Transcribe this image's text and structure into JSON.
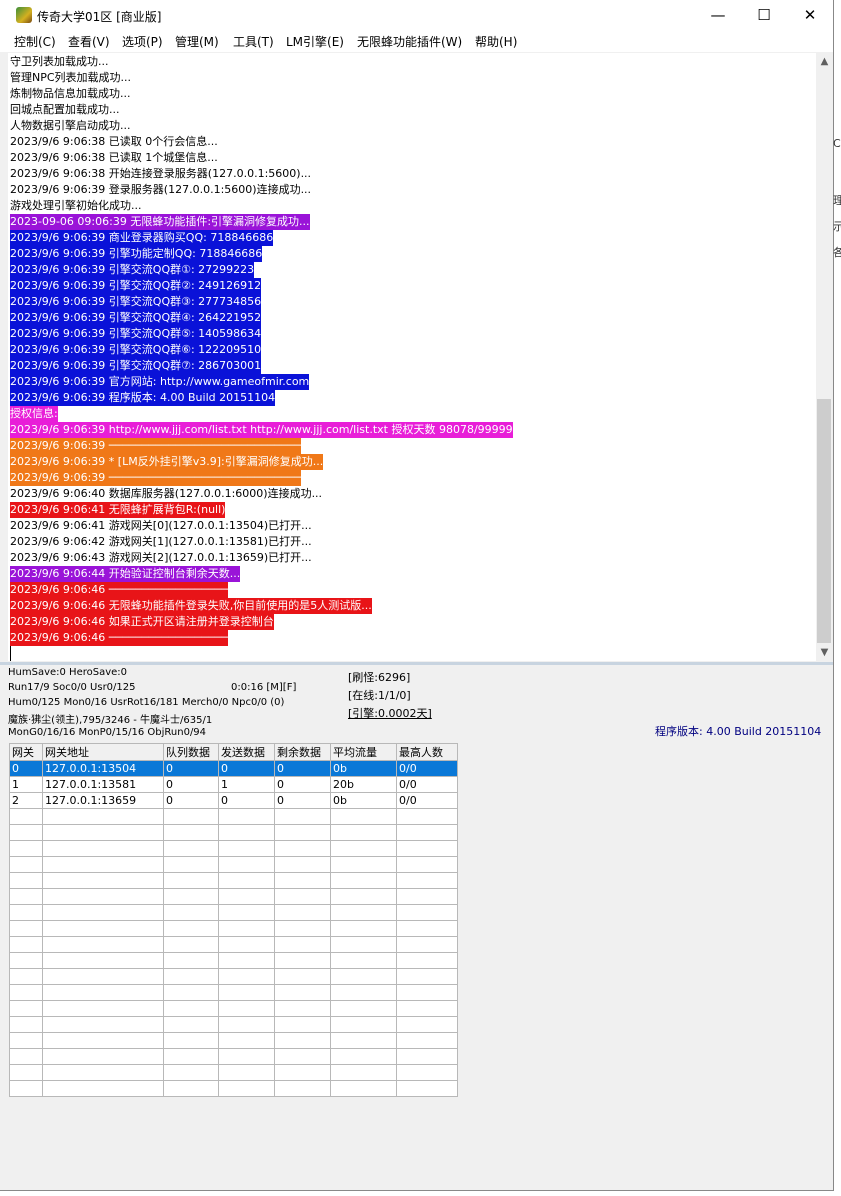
{
  "window": {
    "title": "传奇大学01区 [商业版]",
    "controls": {
      "minimize": "—",
      "maximize": "☐",
      "close": "✕"
    }
  },
  "menu": [
    "控制(C)",
    "查看(V)",
    "选项(P)",
    "管理(M)",
    "工具(T)",
    "LM引擎(E)",
    "无限蜂功能插件(W)",
    "帮助(H)"
  ],
  "log_lines": [
    {
      "text": "守卫列表加载成功...",
      "bg": "",
      "fg": "#000000"
    },
    {
      "text": "管理NPC列表加载成功...",
      "bg": "",
      "fg": "#000000"
    },
    {
      "text": "炼制物品信息加载成功...",
      "bg": "",
      "fg": "#000000"
    },
    {
      "text": "回城点配置加载成功...",
      "bg": "",
      "fg": "#000000"
    },
    {
      "text": "人物数据引擎启动成功...",
      "bg": "",
      "fg": "#000000"
    },
    {
      "text": "2023/9/6 9:06:38 已读取 0个行会信息...",
      "bg": "",
      "fg": "#000000"
    },
    {
      "text": "2023/9/6 9:06:38 已读取 1个城堡信息...",
      "bg": "",
      "fg": "#000000"
    },
    {
      "text": "2023/9/6 9:06:38 开始连接登录服务器(127.0.0.1:5600)...",
      "bg": "",
      "fg": "#000000"
    },
    {
      "text": "2023/9/6 9:06:39 登录服务器(127.0.0.1:5600)连接成功...",
      "bg": "",
      "fg": "#000000"
    },
    {
      "text": "游戏处理引擎初始化成功...",
      "bg": "",
      "fg": "#000000"
    },
    {
      "text": "2023-09-06 09:06:39 无限蜂功能插件:引擎漏洞修复成功...",
      "bg": "#9a14d8",
      "fg": "#ffffff"
    },
    {
      "text": "2023/9/6 9:06:39 商业登录器购买QQ: 718846686",
      "bg": "#0a12d8",
      "fg": "#ffffff"
    },
    {
      "text": "2023/9/6 9:06:39 引擎功能定制QQ: 718846686",
      "bg": "#0a12d8",
      "fg": "#ffffff"
    },
    {
      "text": "2023/9/6 9:06:39 引擎交流QQ群①: 27299223",
      "bg": "#0a12d8",
      "fg": "#ffffff"
    },
    {
      "text": "2023/9/6 9:06:39 引擎交流QQ群②: 249126912",
      "bg": "#0a12d8",
      "fg": "#ffffff"
    },
    {
      "text": "2023/9/6 9:06:39 引擎交流QQ群③: 277734856",
      "bg": "#0a12d8",
      "fg": "#ffffff"
    },
    {
      "text": "2023/9/6 9:06:39 引擎交流QQ群④: 264221952",
      "bg": "#0a12d8",
      "fg": "#ffffff"
    },
    {
      "text": "2023/9/6 9:06:39 引擎交流QQ群⑤: 140598634",
      "bg": "#0a12d8",
      "fg": "#ffffff"
    },
    {
      "text": "2023/9/6 9:06:39 引擎交流QQ群⑥: 122209510",
      "bg": "#0a12d8",
      "fg": "#ffffff"
    },
    {
      "text": "2023/9/6 9:06:39 引擎交流QQ群⑦: 286703001",
      "bg": "#0a12d8",
      "fg": "#ffffff"
    },
    {
      "text": "2023/9/6 9:06:39 官方网站: http://www.gameofmir.com",
      "bg": "#0a12d8",
      "fg": "#ffffff"
    },
    {
      "text": "2023/9/6 9:06:39 程序版本: 4.00 Build 20151104",
      "bg": "#0a12d8",
      "fg": "#ffffff"
    },
    {
      "text": "授权信息:",
      "bg": "#e81ed8",
      "fg": "#ffffff"
    },
    {
      "text": "2023/9/6 9:06:39 http://www.jjj.com/list.txt http://www.jjj.com/list.txt 授权天数 98078/99999",
      "bg": "#e81ed8",
      "fg": "#ffffff"
    },
    {
      "text": "2023/9/6 9:06:39 ─────────────────────────────",
      "bg": "#f07818",
      "fg": "#ffffff"
    },
    {
      "text": "2023/9/6 9:06:39 * [LM反外挂引擎v3.9]:引擎漏洞修复成功...",
      "bg": "#f07818",
      "fg": "#ffffff"
    },
    {
      "text": "2023/9/6 9:06:39 ─────────────────────────────",
      "bg": "#f07818",
      "fg": "#ffffff"
    },
    {
      "text": "2023/9/6 9:06:40 数据库服务器(127.0.0.1:6000)连接成功...",
      "bg": "",
      "fg": "#000000"
    },
    {
      "text": "2023/9/6 9:06:41 无限蜂扩展背包R:(null)",
      "bg": "#e81418",
      "fg": "#ffffff"
    },
    {
      "text": "2023/9/6 9:06:41 游戏网关[0](127.0.0.1:13504)已打开...",
      "bg": "",
      "fg": "#000000"
    },
    {
      "text": "2023/9/6 9:06:42 游戏网关[1](127.0.0.1:13581)已打开...",
      "bg": "",
      "fg": "#000000"
    },
    {
      "text": "2023/9/6 9:06:43 游戏网关[2](127.0.0.1:13659)已打开...",
      "bg": "",
      "fg": "#000000"
    },
    {
      "text": "2023/9/6 9:06:44 开始验证控制台剩余天数...",
      "bg": "#9a14d8",
      "fg": "#ffffff"
    },
    {
      "text": "2023/9/6 9:06:46 ──────────────────",
      "bg": "#e81418",
      "fg": "#ffffff"
    },
    {
      "text": "2023/9/6 9:06:46 无限蜂功能插件登录失败,你目前使用的是5人测试版...",
      "bg": "#e81418",
      "fg": "#ffffff"
    },
    {
      "text": "2023/9/6 9:06:46 如果正式开区请注册并登录控制台",
      "bg": "#e81418",
      "fg": "#ffffff"
    },
    {
      "text": "2023/9/6 9:06:46 ──────────────────",
      "bg": "#e81418",
      "fg": "#ffffff"
    }
  ],
  "status": {
    "line1": "HumSave:0 HeroSave:0",
    "line2": "Run17/9 Soc0/0 Usr0/125",
    "timer": "0:0:16 [M][F]",
    "line3": "Hum0/125 Mon0/16 UsrRot16/181 Merch0/0 Npc0/0 (0)",
    "line4": "魔族·狒尘(领主),795/3246 - 牛魔斗士/635/1",
    "line5": "MonG0/16/16 MonP0/15/16 ObjRun0/94",
    "refresh": "[刷怪:6296]",
    "online": "[在线:1/1/0]",
    "engine": "[引擎:0.0002天]",
    "version": "程序版本: 4.00 Build 20151104"
  },
  "grid": {
    "headers": [
      "网关",
      "网关地址",
      "队列数据",
      "发送数据",
      "剩余数据",
      "平均流量",
      "最高人数"
    ],
    "rows": [
      [
        "0",
        "127.0.0.1:13504",
        "0",
        "0",
        "0",
        "0b",
        "0/0"
      ],
      [
        "1",
        "127.0.0.1:13581",
        "0",
        "1",
        "0",
        "20b",
        "0/0"
      ],
      [
        "2",
        "127.0.0.1:13659",
        "0",
        "0",
        "0",
        "0b",
        "0/0"
      ]
    ],
    "empty_rows": 18,
    "selected_row": 0
  },
  "side_fragments": [
    "C",
    "理",
    "示",
    "各"
  ]
}
